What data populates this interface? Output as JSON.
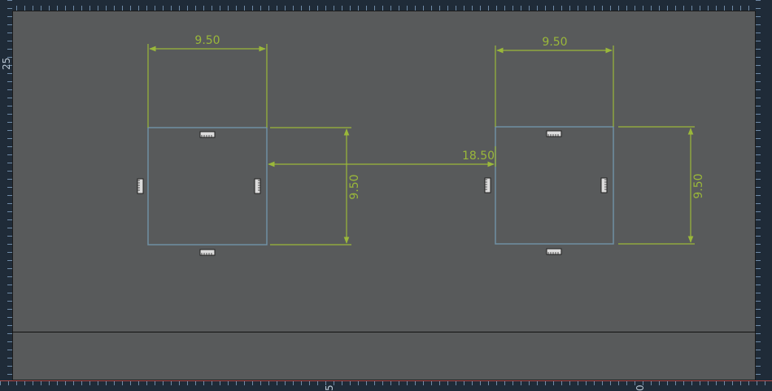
{
  "rulers": {
    "left_label": "25",
    "bottom_labels": [
      "5",
      "0"
    ]
  },
  "dimensions": {
    "left_width": "9.50",
    "left_height": "9.50",
    "right_width": "9.50",
    "right_height": "9.50",
    "gap": "18.50"
  },
  "colors": {
    "dimension_line": "#9ab83a",
    "shape_outline": "#6f8fa3",
    "background": "#585a5b"
  }
}
